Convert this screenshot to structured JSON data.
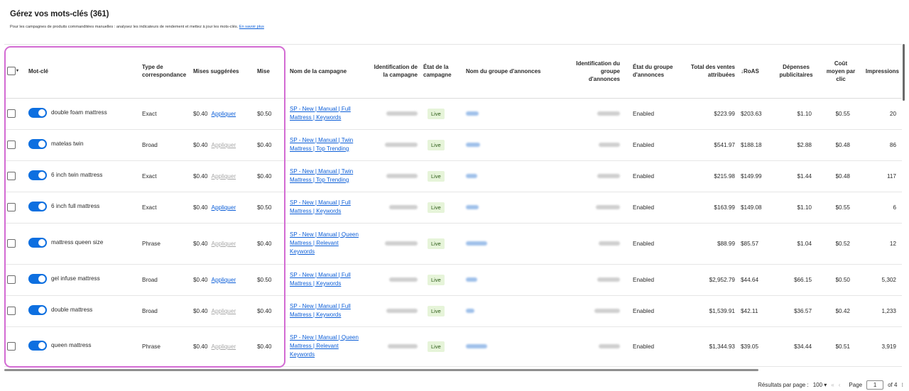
{
  "header": {
    "title": "Gérez vos mots-clés (361)",
    "subtitle": "Pour les campagnes de produits commanditées manuelles : analysez les indicateurs de rendement et mettez à jour les mots-clés.",
    "learn_more": "En savoir plus"
  },
  "columns": {
    "keyword": "Mot-clé",
    "match_type": "Type de correspondance",
    "suggested_bids": "Mises suggérées",
    "bid": "Mise",
    "campaign_name": "Nom de la campagne",
    "campaign_id": "Identification de la campagne",
    "campaign_status": "État de la campagne",
    "ad_group_name": "Nom du groupe d'annonces",
    "ad_group_id": "Identification du groupe d'annonces",
    "ad_group_status": "État du groupe d'annonces",
    "total_sales": "Total des ventes attribuées",
    "roas": "↓RoAS",
    "ad_spend": "Dépenses publicitaires",
    "cpc": "Coût moyen par clic",
    "impressions": "Impressions"
  },
  "rows": [
    {
      "keyword": "double foam mattress",
      "match": "Exact",
      "suggested": "$0.40",
      "apply": "Appliquer",
      "apply_enabled": true,
      "bid": "$0.50",
      "campaign": "SP - New | Manual | Full Mattress | Keywords",
      "status": "Live",
      "ag_status": "Enabled",
      "sales": "$223.99",
      "roas": "$203.63",
      "spend": "$1.10",
      "cpc": "$0.55",
      "impr": "20"
    },
    {
      "keyword": "matelas twin",
      "match": "Broad",
      "suggested": "$0.40",
      "apply": "Appliquer",
      "apply_enabled": false,
      "bid": "$0.40",
      "campaign": "SP - New | Manual | Twin Mattress | Top Trending",
      "status": "Live",
      "ag_status": "Enabled",
      "sales": "$541.97",
      "roas": "$188.18",
      "spend": "$2.88",
      "cpc": "$0.48",
      "impr": "86"
    },
    {
      "keyword": "6 inch twin mattress",
      "match": "Exact",
      "suggested": "$0.40",
      "apply": "Appliquer",
      "apply_enabled": false,
      "bid": "$0.40",
      "campaign": "SP - New | Manual | Twin Mattress | Top Trending",
      "status": "Live",
      "ag_status": "Enabled",
      "sales": "$215.98",
      "roas": "$149.99",
      "spend": "$1.44",
      "cpc": "$0.48",
      "impr": "117"
    },
    {
      "keyword": "6 inch full mattress",
      "match": "Exact",
      "suggested": "$0.40",
      "apply": "Appliquer",
      "apply_enabled": true,
      "bid": "$0.50",
      "campaign": "SP - New | Manual | Full Mattress | Keywords",
      "status": "Live",
      "ag_status": "Enabled",
      "sales": "$163.99",
      "roas": "$149.08",
      "spend": "$1.10",
      "cpc": "$0.55",
      "impr": "6"
    },
    {
      "keyword": "mattress queen size",
      "match": "Phrase",
      "suggested": "$0.40",
      "apply": "Appliquer",
      "apply_enabled": false,
      "bid": "$0.40",
      "campaign": "SP - New | Manual | Queen Mattress | Relevant Keywords",
      "status": "Live",
      "ag_status": "Enabled",
      "sales": "$88.99",
      "roas": "$85.57",
      "spend": "$1.04",
      "cpc": "$0.52",
      "impr": "12"
    },
    {
      "keyword": "gel infuse mattress",
      "match": "Broad",
      "suggested": "$0.40",
      "apply": "Appliquer",
      "apply_enabled": true,
      "bid": "$0.50",
      "campaign": "SP - New | Manual | Full Mattress | Keywords",
      "status": "Live",
      "ag_status": "Enabled",
      "sales": "$2,952.79",
      "roas": "$44.64",
      "spend": "$66.15",
      "cpc": "$0.50",
      "impr": "5,302"
    },
    {
      "keyword": "double mattress",
      "match": "Broad",
      "suggested": "$0.40",
      "apply": "Appliquer",
      "apply_enabled": false,
      "bid": "$0.40",
      "campaign": "SP - New | Manual | Full Mattress | Keywords",
      "status": "Live",
      "ag_status": "Enabled",
      "sales": "$1,539.91",
      "roas": "$42.11",
      "spend": "$36.57",
      "cpc": "$0.42",
      "impr": "1,233"
    },
    {
      "keyword": "queen mattress",
      "match": "Phrase",
      "suggested": "$0.40",
      "apply": "Appliquer",
      "apply_enabled": false,
      "bid": "$0.40",
      "campaign": "SP - New | Manual | Queen Mattress | Relevant Keywords",
      "status": "Live",
      "ag_status": "Enabled",
      "sales": "$1,344.93",
      "roas": "$39.05",
      "spend": "$34.44",
      "cpc": "$0.51",
      "impr": "3,919"
    }
  ],
  "row_heights": [
    44,
    44,
    44,
    44,
    58,
    44,
    44,
    56
  ],
  "pagination": {
    "per_page_label": "Résultats par page :",
    "per_page_value": "100",
    "page_label": "Page",
    "current_page": "1",
    "of_pages": "of 4"
  },
  "icons": {
    "select_caret": "chevron-down-icon",
    "sort": "sort-desc-arrow",
    "first_page": "double-chevron-left-icon",
    "prev_page": "chevron-left-icon",
    "menu": "kebab-icon"
  },
  "colors": {
    "link": "#0d5fd8",
    "toggle_on": "#0d6fe0",
    "live_badge_bg": "#e6f4d9",
    "highlight_border": "#d36bd3"
  }
}
